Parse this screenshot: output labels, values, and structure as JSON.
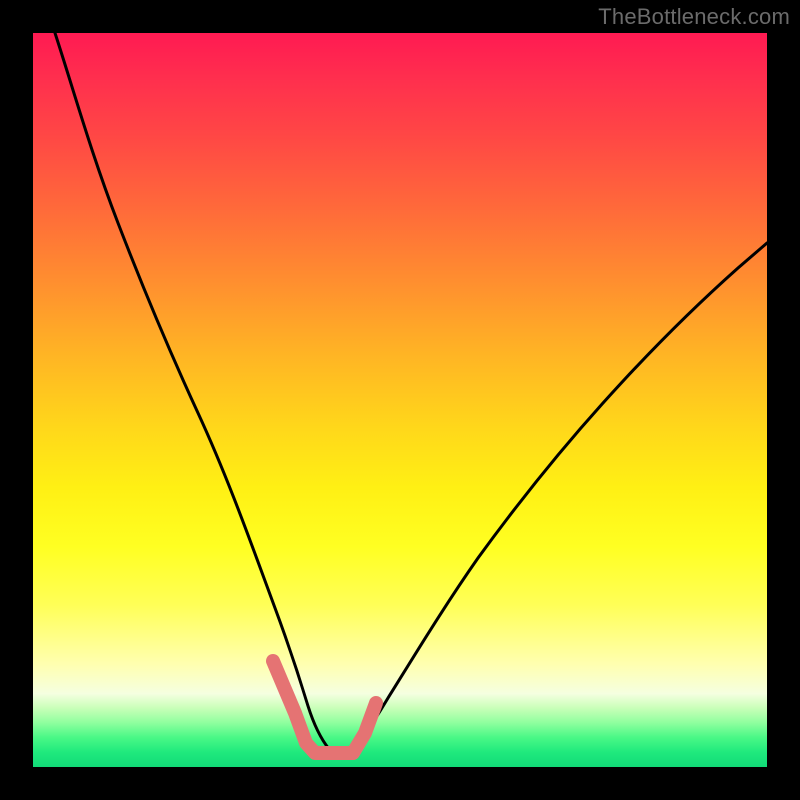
{
  "watermark": "TheBottleneck.com",
  "colors": {
    "page_bg": "#000000",
    "curve_main": "#000000",
    "curve_highlight": "#e57373",
    "gradient_stops": [
      "#ff1a52",
      "#ff2e4e",
      "#ff4745",
      "#ff6a3a",
      "#ff8f2f",
      "#ffb524",
      "#ffd81a",
      "#fff014",
      "#ffff22",
      "#ffff58",
      "#ffffb0",
      "#f5ffe0",
      "#c8ffb8",
      "#8eff9e",
      "#49f886",
      "#1fe97d",
      "#12db78"
    ]
  },
  "chart_data": {
    "type": "line",
    "title": "",
    "xlabel": "",
    "ylabel": "",
    "xlim": [
      0,
      100
    ],
    "ylim": [
      0,
      100
    ],
    "note": "Axes are unlabeled in the image. x/y values are estimated from pixel positions on a 0–100 scale (x left→right, y bottom→top). The chart shows a V-shaped curve with minimum roughly between x≈36–43 at y≈2, rising steeply on both sides; a pink highlight marks the near-flat trough region.",
    "series": [
      {
        "name": "bottleneck-curve",
        "color": "#000000",
        "x": [
          3,
          6,
          10,
          14,
          18,
          22,
          26,
          30,
          33,
          36,
          38,
          40,
          43,
          46,
          50,
          55,
          60,
          66,
          74,
          84,
          96,
          100
        ],
        "y": [
          100,
          91,
          79,
          66,
          54,
          42,
          31,
          21,
          13,
          6,
          3,
          2,
          3,
          6,
          12,
          19,
          27,
          35,
          44,
          53,
          62,
          65
        ]
      },
      {
        "name": "highlight-trough",
        "color": "#e57373",
        "x": [
          33,
          35,
          37,
          39,
          41,
          43,
          45
        ],
        "y": [
          13,
          7,
          3,
          2,
          2,
          3,
          8
        ]
      }
    ]
  }
}
